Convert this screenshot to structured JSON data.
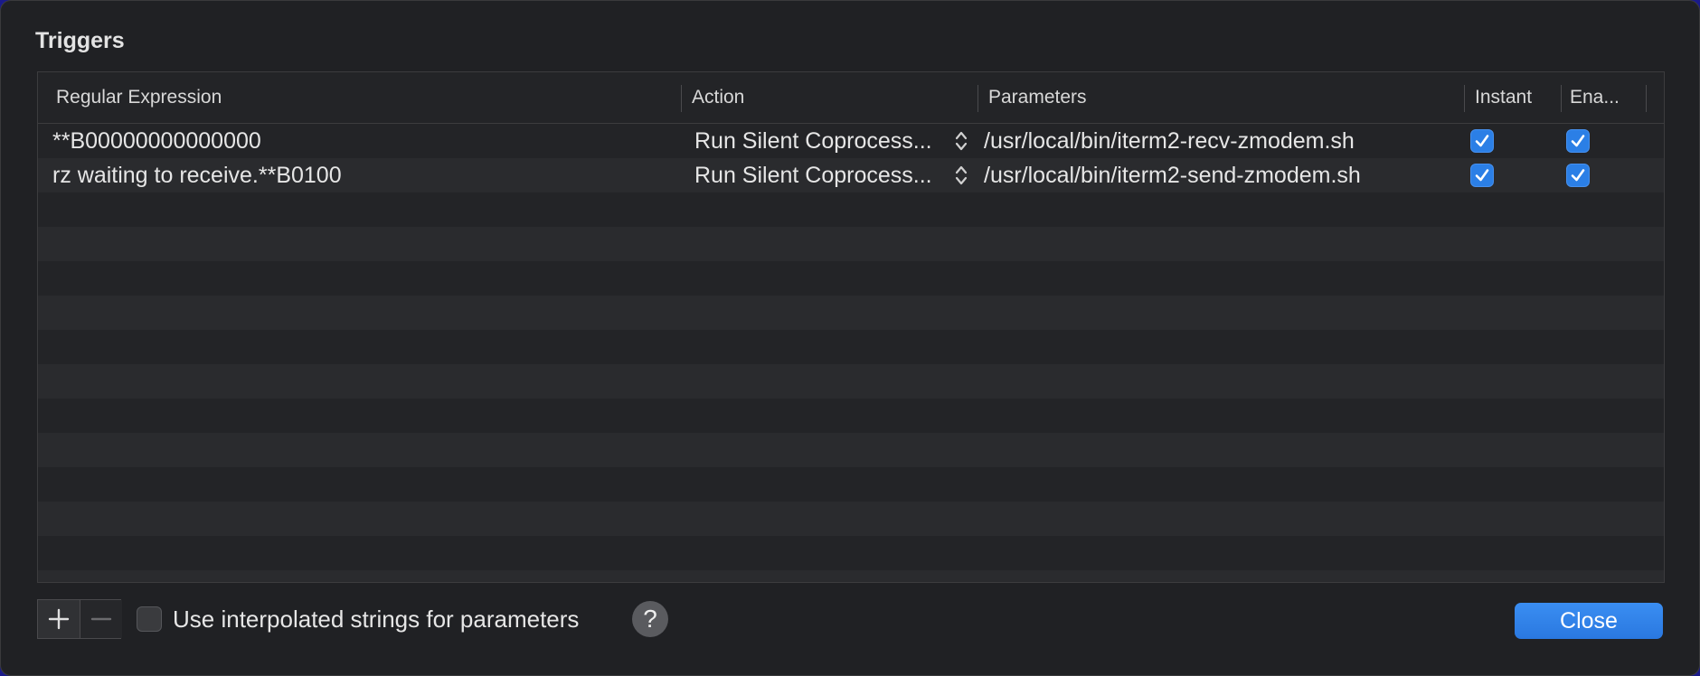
{
  "title": "Triggers",
  "columns": {
    "regex": "Regular Expression",
    "action": "Action",
    "parameters": "Parameters",
    "instant": "Instant",
    "enabled": "Ena..."
  },
  "rows": [
    {
      "regex": "**B00000000000000",
      "action": "Run Silent Coprocess...",
      "parameters": "/usr/local/bin/iterm2-recv-zmodem.sh",
      "instant": true,
      "enabled": true
    },
    {
      "regex": "rz waiting to receive.**B0100",
      "action": "Run Silent Coprocess...",
      "parameters": "/usr/local/bin/iterm2-send-zmodem.sh",
      "instant": true,
      "enabled": true
    }
  ],
  "footer": {
    "interpolated_label": "Use interpolated strings for parameters",
    "interpolated_checked": false,
    "help_label": "?",
    "close_label": "Close"
  },
  "colors": {
    "accent": "#2b7fe6",
    "background": "#202124"
  }
}
